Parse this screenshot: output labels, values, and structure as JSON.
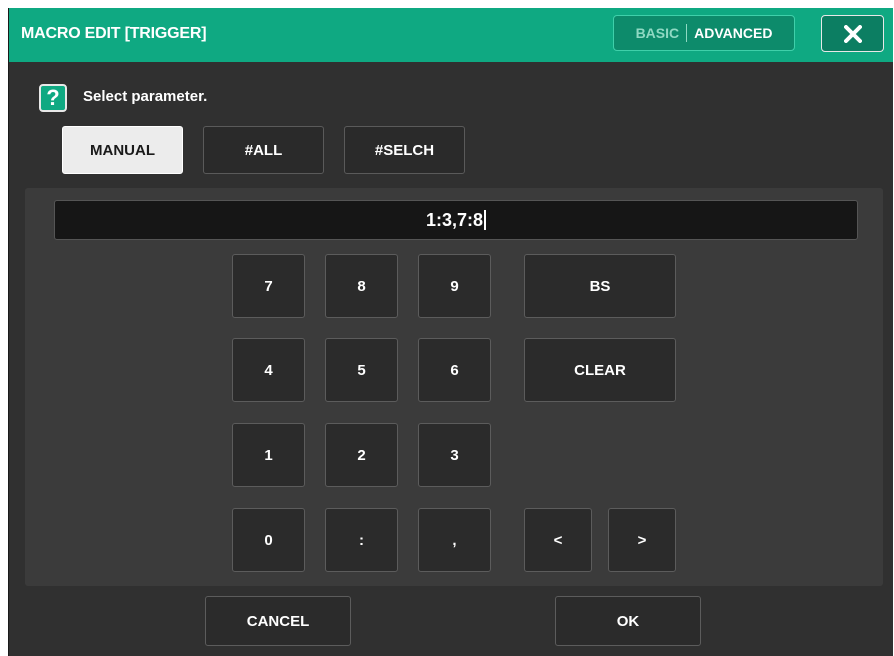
{
  "window": {
    "title": "MACRO EDIT [TRIGGER]",
    "mode_toggle": {
      "basic": "BASIC",
      "advanced": "ADVANCED",
      "selected": "ADVANCED"
    },
    "close_icon": "close-x-icon"
  },
  "help": {
    "icon": "?",
    "text": "Select parameter."
  },
  "modes": {
    "manual": "MANUAL",
    "all": "#ALL",
    "selch": "#SELCH",
    "selected": "MANUAL"
  },
  "display": {
    "value": "1:3,7:8"
  },
  "keypad": {
    "k7": "7",
    "k8": "8",
    "k9": "9",
    "k4": "4",
    "k5": "5",
    "k6": "6",
    "k1": "1",
    "k2": "2",
    "k3": "3",
    "k0": "0",
    "colon": ":",
    "comma": ",",
    "bs": "BS",
    "clear": "CLEAR",
    "left": "<",
    "right": ">"
  },
  "footer": {
    "cancel": "CANCEL",
    "ok": "OK"
  },
  "colors": {
    "accent": "#0fa982",
    "background": "#303030",
    "panel": "#3b3b3b",
    "display": "#161616"
  }
}
